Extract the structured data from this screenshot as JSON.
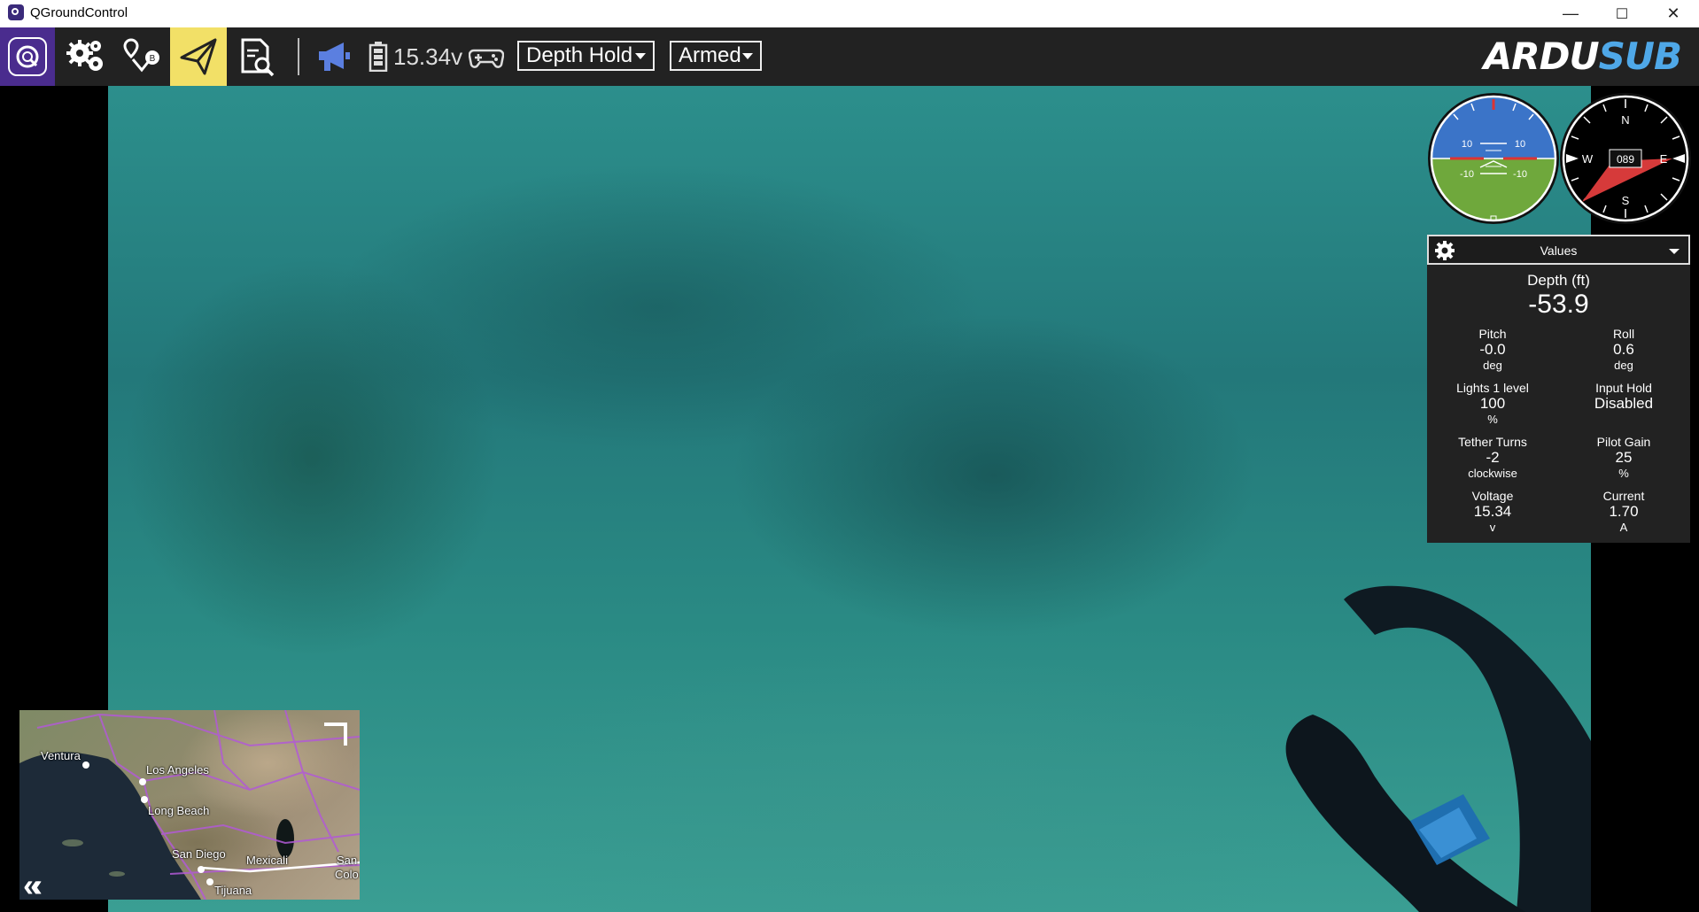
{
  "window": {
    "title": "QGroundControl",
    "controls": {
      "minimize": "—",
      "maximize": "☐",
      "close": "✕"
    }
  },
  "toolbar": {
    "buttons": [
      {
        "name": "qgc-menu",
        "icon": "qgroundcontrol-logo-icon"
      },
      {
        "name": "vehicle-setup",
        "icon": "gears-icon"
      },
      {
        "name": "plan",
        "icon": "plan-route-icon"
      },
      {
        "name": "fly",
        "icon": "paper-plane-icon",
        "active": true,
        "active_color": "#f2e067"
      },
      {
        "name": "analyze",
        "icon": "document-search-icon"
      }
    ],
    "status": {
      "messages_icon": "megaphone-icon",
      "battery_icon": "battery-icon",
      "battery_voltage": "15.34v",
      "joystick_icon": "gamepad-icon"
    },
    "flight_mode": "Depth Hold",
    "arm_state": "Armed",
    "brand_logo": {
      "part1": "ARDU",
      "part2": "SUB"
    }
  },
  "instruments": {
    "attitude": {
      "pitch_labels": [
        "10",
        "10",
        "-10",
        "-10"
      ]
    },
    "compass": {
      "heading": "089",
      "n": "N",
      "e": "E",
      "s": "S",
      "w": "W"
    }
  },
  "values_panel": {
    "title": "Values",
    "primary": {
      "label": "Depth (ft)",
      "value": "-53.9"
    },
    "items": [
      {
        "label": "Pitch",
        "value": "-0.0",
        "unit": "deg"
      },
      {
        "label": "Roll",
        "value": "0.6",
        "unit": "deg"
      },
      {
        "label": "Lights 1 level",
        "value": "100",
        "unit": "%"
      },
      {
        "label": "Input Hold",
        "value": "Disabled",
        "unit": ""
      },
      {
        "label": "Tether Turns",
        "value": "-2",
        "unit": "clockwise"
      },
      {
        "label": "Pilot Gain",
        "value": "25",
        "unit": "%"
      },
      {
        "label": "Voltage",
        "value": "15.34",
        "unit": "v"
      },
      {
        "label": "Current",
        "value": "1.70",
        "unit": "A"
      }
    ]
  },
  "map": {
    "places": [
      "Ventura",
      "Los Angeles",
      "Long Beach",
      "San Diego",
      "Mexicali",
      "Tijuana",
      "San",
      "Colo"
    ],
    "collapse_icon": "double-chevron-left-icon",
    "expand_icon": "expand-corner-icon"
  }
}
